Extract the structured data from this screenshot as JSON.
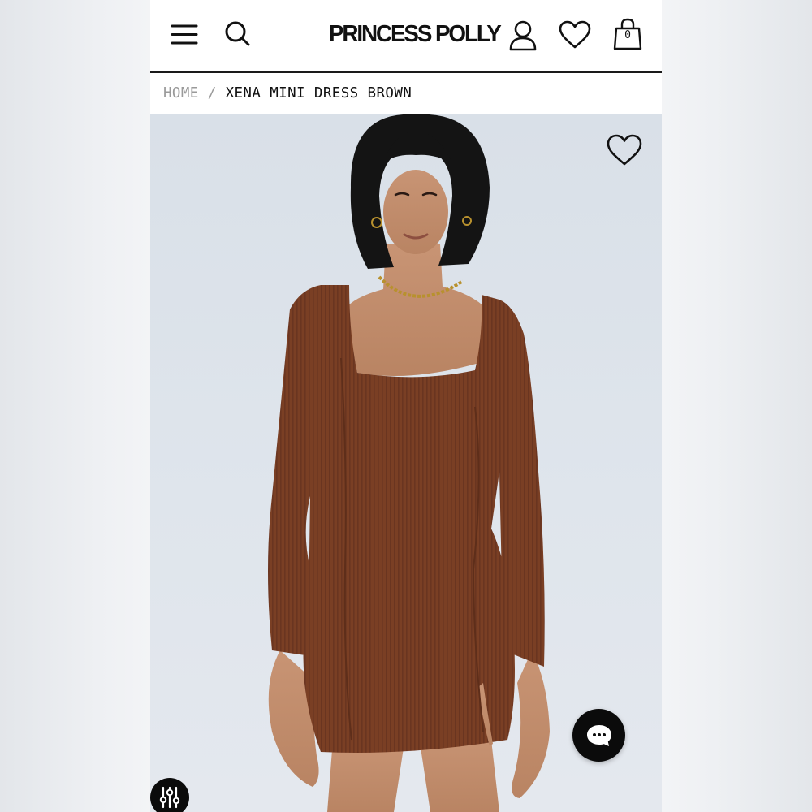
{
  "header": {
    "menu_icon": "hamburger-menu-icon",
    "search_icon": "search-icon",
    "logo_text": "PRINCESS POLLY",
    "account_icon": "user-icon",
    "wishlist_icon": "heart-icon",
    "cart_icon": "shopping-bag-icon",
    "cart_count": "0"
  },
  "breadcrumb": {
    "home": "HOME",
    "separator": "/",
    "current": "XENA MINI DRESS BROWN"
  },
  "product_image": {
    "alt": "XENA MINI DRESS BROWN",
    "wishlist_icon": "heart-outline-icon",
    "dress_color": "#7a3f24",
    "background_color": "#dde3ea"
  },
  "floating": {
    "chat_icon": "chat-bubble-icon",
    "filter_icon": "sliders-icon"
  },
  "colors": {
    "text": "#111111",
    "muted": "#9a9a9a",
    "divider": "#1a1a1a",
    "button_bg": "#0b0b0b"
  }
}
